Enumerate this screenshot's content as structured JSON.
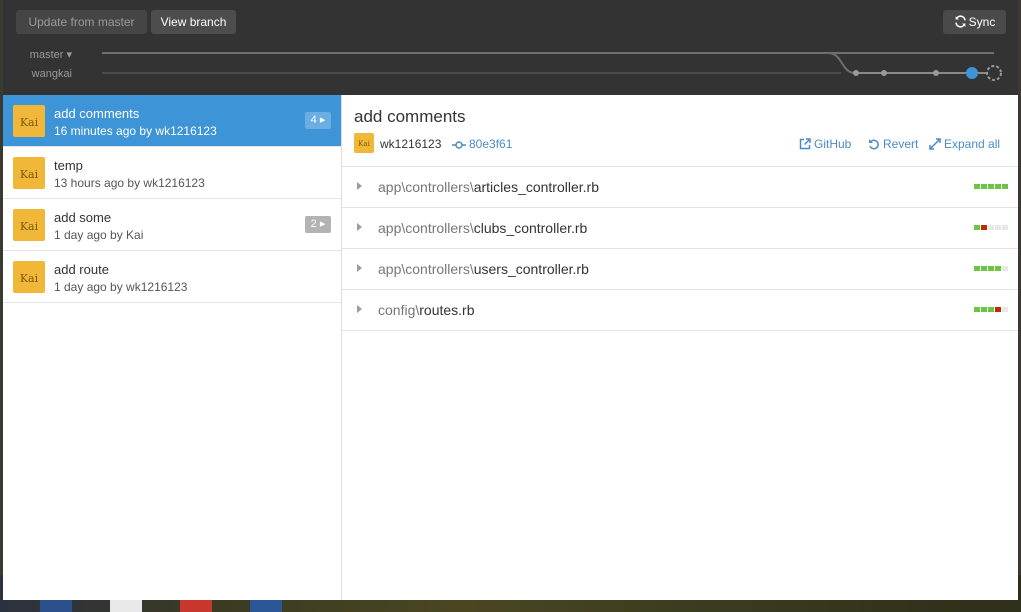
{
  "toolbar": {
    "update_label": "Update from master",
    "view_branch_label": "View branch",
    "sync_label": "Sync",
    "sync_icon": "sync-icon"
  },
  "branches": {
    "master_label": "master ▾",
    "wangkai_label": "wangkai"
  },
  "commits": [
    {
      "title": "add comments",
      "meta": "16 minutes ago by wk1216123",
      "badge": "4 ▸",
      "selected": true
    },
    {
      "title": "temp",
      "meta": "13 hours ago by wk1216123",
      "badge": null,
      "selected": false
    },
    {
      "title": "add some",
      "meta": "1 day ago by Kai",
      "badge": "2 ▸",
      "selected": false
    },
    {
      "title": "add route",
      "meta": "1 day ago by wk1216123",
      "badge": null,
      "selected": false
    }
  ],
  "detail": {
    "title": "add comments",
    "author": "wk1216123",
    "sha": "80e3f61",
    "actions": {
      "github": "GitHub",
      "revert": "Revert",
      "expand": "Expand all"
    },
    "files": [
      {
        "dir": "app\\controllers\\",
        "name": "articles_controller.rb",
        "diffstat": [
          "add",
          "add",
          "add",
          "add",
          "add"
        ]
      },
      {
        "dir": "app\\controllers\\",
        "name": "clubs_controller.rb",
        "diffstat": [
          "add",
          "del",
          "none",
          "none",
          "none"
        ]
      },
      {
        "dir": "app\\controllers\\",
        "name": "users_controller.rb",
        "diffstat": [
          "add",
          "add",
          "add",
          "add",
          "none"
        ]
      },
      {
        "dir": "config\\",
        "name": "routes.rb",
        "diffstat": [
          "add",
          "add",
          "add",
          "del",
          "none"
        ]
      }
    ]
  },
  "colors": {
    "toolbar_bg": "#333333",
    "selected_bg": "#3d94d6",
    "link": "#4a8bc8",
    "add": "#6cc644",
    "del": "#bd2c00",
    "avatar": "#f1b739"
  },
  "avatar_text": "Kai"
}
